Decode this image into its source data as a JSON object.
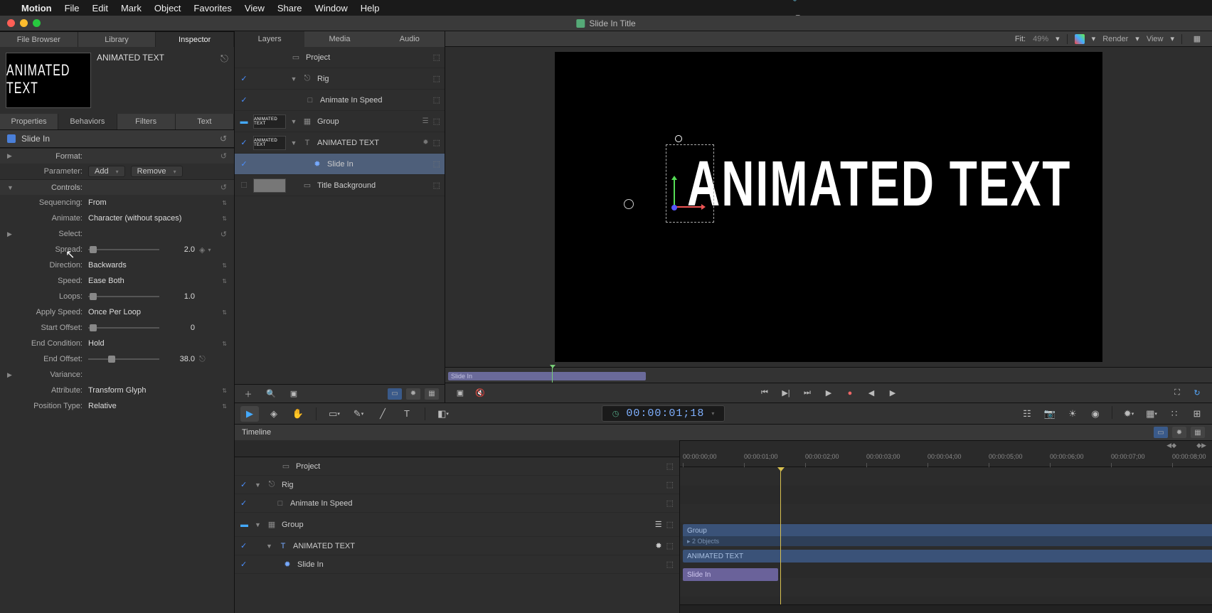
{
  "menubar": {
    "app": "Motion",
    "items": [
      "File",
      "Edit",
      "Mark",
      "Object",
      "Favorites",
      "View",
      "Share",
      "Window",
      "Help"
    ]
  },
  "window_title": "Slide In Title",
  "left_tabs": [
    "File Browser",
    "Library",
    "Inspector"
  ],
  "object_title": "ANIMATED TEXT",
  "thumb_text": "ANIMATED TEXT",
  "insp_tabs": [
    "Properties",
    "Behaviors",
    "Filters",
    "Text"
  ],
  "behavior_header": "Slide In",
  "format_label": "Format:",
  "parameter_label": "Parameter:",
  "param_add": "Add",
  "param_remove": "Remove",
  "controls_label": "Controls:",
  "params": {
    "sequencing": {
      "label": "Sequencing:",
      "value": "From"
    },
    "animate": {
      "label": "Animate:",
      "value": "Character (without spaces)"
    },
    "select": {
      "label": "Select:"
    },
    "spread": {
      "label": "Spread:",
      "value": "2.0"
    },
    "direction": {
      "label": "Direction:",
      "value": "Backwards"
    },
    "speed": {
      "label": "Speed:",
      "value": "Ease Both"
    },
    "loops": {
      "label": "Loops:",
      "value": "1.0"
    },
    "apply_speed": {
      "label": "Apply Speed:",
      "value": "Once Per Loop"
    },
    "start_offset": {
      "label": "Start Offset:",
      "value": "0"
    },
    "end_condition": {
      "label": "End Condition:",
      "value": "Hold"
    },
    "end_offset": {
      "label": "End Offset:",
      "value": "38.0"
    },
    "variance": {
      "label": "Variance:"
    },
    "attribute": {
      "label": "Attribute:",
      "value": "Transform Glyph"
    },
    "position_type": {
      "label": "Position Type:",
      "value": "Relative"
    }
  },
  "layers_tabs": [
    "Layers",
    "Media",
    "Audio"
  ],
  "layers": {
    "project": "Project",
    "rig": "Rig",
    "anim_widget": "Animate In Speed",
    "group": "Group",
    "text": "ANIMATED TEXT",
    "slide_in": "Slide In",
    "title_bg": "Title Background"
  },
  "canvas_toolbar": {
    "fit": "Fit:",
    "pct": "49%",
    "render": "Render",
    "view": "View"
  },
  "canvas_text": "ANIMATED TEXT",
  "mini_bar": "Slide In",
  "timecode": "00:00:01;18",
  "timeline_label": "Timeline",
  "ruler_ticks": [
    "00:00:00;00",
    "00:00:01;00",
    "00:00:02;00",
    "00:00:03;00",
    "00:00:04;00",
    "00:00:05;00",
    "00:00:06;00",
    "00:00:07;00",
    "00:00:08;00"
  ],
  "tl_rows": {
    "project": "Project",
    "rig": "Rig",
    "anim_widget": "Animate In Speed",
    "group": "Group",
    "text": "ANIMATED TEXT",
    "slide_in": "Slide In"
  },
  "clips": {
    "group": "Group",
    "two_objects": "▸ 2 Objects",
    "text": "ANIMATED TEXT",
    "slide_in": "Slide In"
  }
}
